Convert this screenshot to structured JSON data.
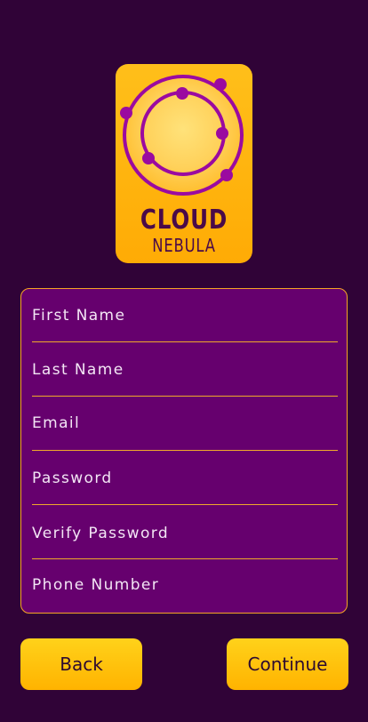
{
  "brand": {
    "line1": "CLOUD",
    "line2": "NEBULA",
    "colors": {
      "badge": "#ffb20f",
      "ink": "#4a0a48",
      "orbit": "#9b0aa0"
    }
  },
  "form": {
    "fields": [
      {
        "label": "First Name"
      },
      {
        "label": "Last Name"
      },
      {
        "label": "Email"
      },
      {
        "label": "Password"
      },
      {
        "label": "Verify Password"
      },
      {
        "label": "Phone Number"
      }
    ]
  },
  "actions": {
    "back_label": "Back",
    "continue_label": "Continue"
  },
  "colors": {
    "background": "#300337",
    "panel": "#66006e",
    "accent": "#f5a623",
    "button": "#ffc20e"
  }
}
